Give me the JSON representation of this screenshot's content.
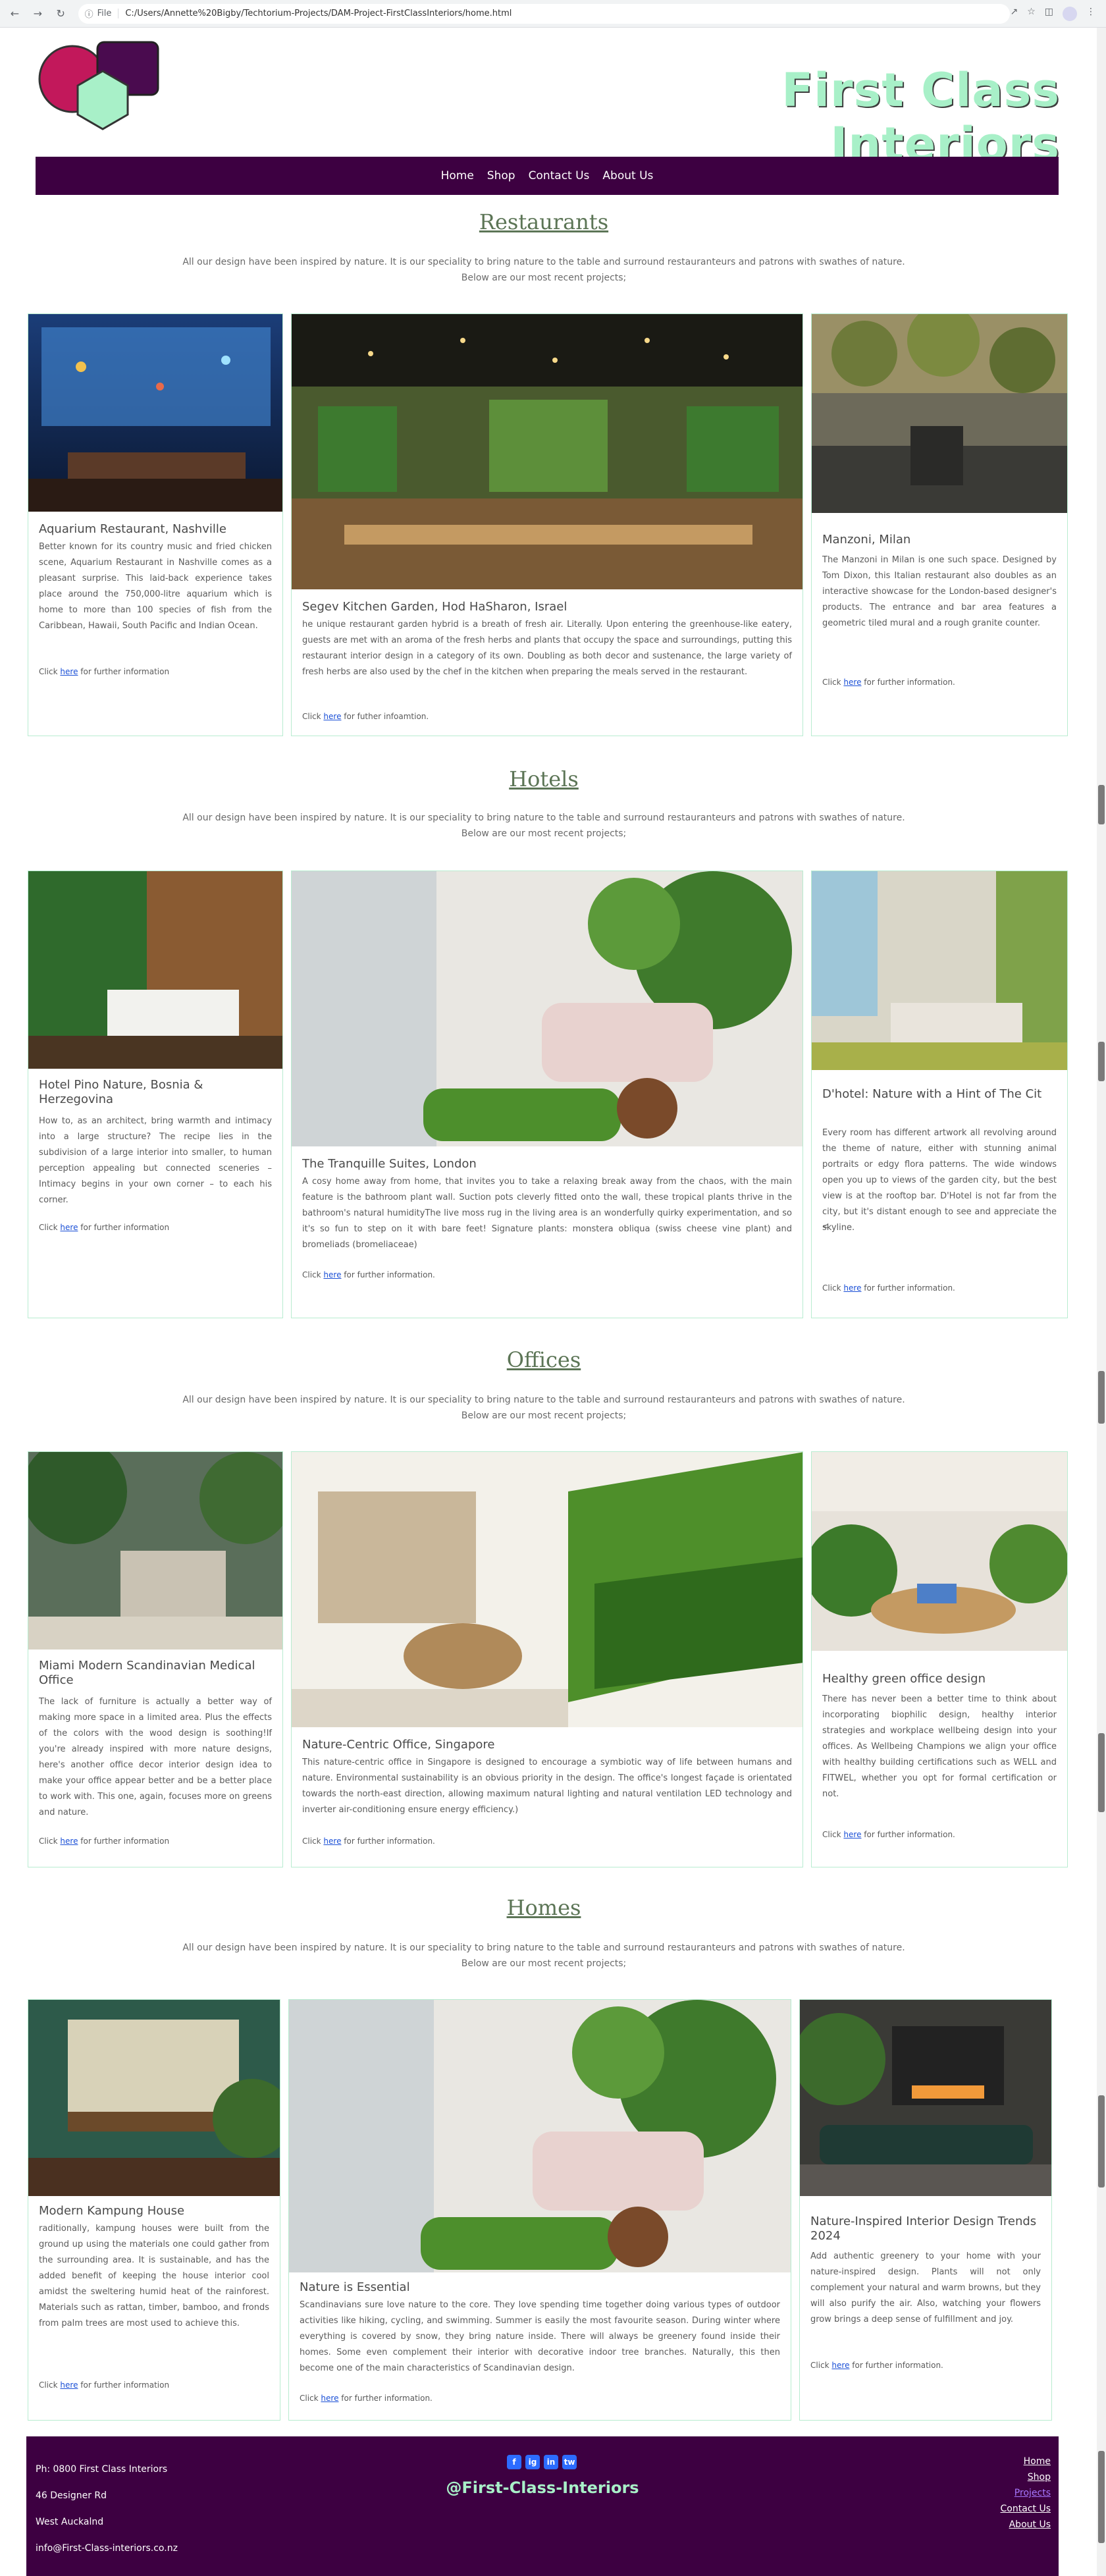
{
  "browser": {
    "scheme_label": "File",
    "url": "C:/Users/Annette%20Bigby/Techtorium-Projects/DAM-Project-FirstClassInteriors/home.html"
  },
  "header": {
    "site_title": "First Class Interiors",
    "nav": [
      "Home",
      "Shop",
      "Contact Us",
      "About Us"
    ]
  },
  "sections": [
    {
      "title": "Restaurants",
      "intro": "All our design have been inspired by nature. It is our speciality to bring nature to the table and surround restauranteurs and patrons with swathes of nature.",
      "intro2": "Below are our most recent projects;",
      "cards": [
        {
          "title": "Aquarium Restaurant, Nashville",
          "text": "Better known for its country music and fried chicken scene, Aquarium Restaurant in Nashville comes as a pleasant surprise. This laid-back experience takes place around the 750,000-litre aquarium which is home to more than 100 species of fish from the Caribbean, Hawaii, South Pacific and Indian Ocean.",
          "more": "Click ",
          "link": "here",
          "after": " for further information"
        },
        {
          "title": "Segev Kitchen Garden, Hod HaSharon, Israel",
          "text": "he unique restaurant garden hybrid is a breath of fresh air. Literally. Upon entering the greenhouse-like eatery, guests are met with an aroma of the fresh herbs and plants that occupy the space and surroundings, putting this restaurant interior design in a category of its own. Doubling as both decor and sustenance, the large variety of fresh herbs are also used by the chef in the kitchen when preparing the meals served in the restaurant.",
          "more": "Click ",
          "link": "here",
          "after": " for futher infoamtion."
        },
        {
          "title": "Manzoni, Milan",
          "text": "The Manzoni in Milan is one such space. Designed by Tom Dixon, this Italian restaurant also doubles as an interactive showcase for the London-based designer's products. The entrance and bar area features a geometric tiled mural and a rough granite counter.",
          "more": "Click ",
          "link": "here",
          "after": " for further information."
        }
      ]
    },
    {
      "title": "Hotels",
      "intro": "All our design have been inspired by nature. It is our speciality to bring nature to the table and surround restauranteurs and patrons with swathes of nature.",
      "intro2": "Below are our most recent projects;",
      "cards": [
        {
          "title": "Hotel Pino Nature, Bosnia & Herzegovina",
          "text": "How to, as an architect, bring warmth and intimacy into a large structure? The recipe lies in the subdivision of a large interior into smaller, to human perception appealing but connected sceneries – Intimacy begins in your own corner – to each his corner.",
          "more": "Click ",
          "link": "here",
          "after": " for further information"
        },
        {
          "title": "The Tranquille Suites, London",
          "text": "A cosy home away from home, that invites you to take a relaxing break away from the chaos, with the main feature is the bathroom plant wall. Suction pots cleverly fitted onto the wall, these tropical plants thrive in the bathroom's natural humidityThe live moss rug in the living area is an wonderfully quirky experimentation, and so it's so fun to step on it with bare feet! Signature plants: monstera obliqua (swiss cheese vine plant) and bromeliads (bromeliaceae)",
          "more": "Click ",
          "link": "here",
          "after": " for further information."
        },
        {
          "title": "D'hotel: Nature with a Hint of The Cit",
          "text": "Every room has different artwork all revolving around the theme of nature, either with stunning animal portraits or edgy flora patterns. The wide windows open you up to views of the garden city, but the best view is at the rooftop bar. D'Hotel is not far from the city, but it's distant enough to see and appreciate the skyline.",
          "extra": "<",
          "more": "Click ",
          "link": "here",
          "after": " for further information."
        }
      ]
    },
    {
      "title": "Offices",
      "intro": "All our design have been inspired by nature. It is our speciality to bring nature to the table and surround restauranteurs and patrons with swathes of nature.",
      "intro2": "Below are our most recent projects;",
      "cards": [
        {
          "title": "Miami Modern Scandinavian Medical Office",
          "text": "The lack of furniture is actually a better way of making more space in a limited area. Plus the effects of the colors with the wood design is soothing!If you're already inspired with more nature designs, here's another office decor interior design idea to make your office appear better and be a better place to work with. This one, again, focuses more on greens and nature.",
          "more": "Click ",
          "link": "here",
          "after": " for further information"
        },
        {
          "title": "Nature-Centric Office, Singapore",
          "text": "This nature-centric office in Singapore is designed to encourage a symbiotic way of life between humans and nature. Environmental sustainability is an obvious priority in the design. The office's longest façade is orientated towards the north-east direction, allowing maximum natural lighting and natural ventilation LED technology and inverter air-conditioning ensure energy efficiency.)",
          "more": "Click ",
          "link": "here",
          "after": " for further information."
        },
        {
          "title": "Healthy green office design",
          "text": "There has never been a better time to think about incorporating biophilic design, healthy interior strategies and workplace wellbeing design into your offices. As Wellbeing Champions we align your office with healthy building certifications such as WELL and FITWEL, whether you opt for formal certification or not.",
          "more": "Click ",
          "link": "here",
          "after": " for further information."
        }
      ]
    },
    {
      "title": "Homes",
      "intro": "All our design have been inspired by nature. It is our speciality to bring nature to the table and surround restauranteurs and patrons with swathes of nature.",
      "intro2": "Below are our most recent projects;",
      "cards": [
        {
          "title": "Modern Kampung House",
          "text": "raditionally, kampung houses were built from the ground up using the materials one could gather from the surrounding area. It is sustainable, and has the added benefit of keeping the house interior cool amidst the sweltering humid heat of the rainforest. Materials such as rattan, timber, bamboo, and fronds from palm trees are most used to achieve this.",
          "more": "Click ",
          "link": "here",
          "after": " for further information"
        },
        {
          "title": "Nature is Essential",
          "text": "Scandinavians sure love nature to the core. They love spending time together doing various types of outdoor activities like hiking, cycling, and swimming. Summer is easily the most favourite season. During winter where everything is covered by snow, they bring nature inside. There will always be greenery found inside their homes. Some even complement their interior with decorative indoor tree branches. Naturally, this then become one of the main characteristics of Scandinavian design.",
          "more": "Click ",
          "link": "here",
          "after": " for further information."
        },
        {
          "title": "Nature-Inspired Interior Design Trends 2024",
          "text": "Add authentic greenery to your home with your nature-inspired design. Plants will not only complement your natural and warm browns, but they will also purify the air. Also, watching your flowers grow brings a deep sense of fulfillment and joy.",
          "more": "Click ",
          "link": "here",
          "after": " for further information."
        }
      ]
    }
  ],
  "footer": {
    "phone": "Ph: 0800 First Class Interiors",
    "address1": "46 Designer Rd",
    "address2": "West Auckalnd",
    "email": "info@First-Class-interiors.co.nz",
    "handle": "@First-Class-Interiors",
    "social": [
      "f",
      "ig",
      "in",
      "tw"
    ],
    "links": [
      "Home",
      "Shop",
      "Projects",
      "Contact Us",
      "About Us"
    ]
  },
  "colors": {
    "brand_purple": "#3d0041",
    "mint": "#a8f0c8",
    "heading_green": "#5c7556",
    "logo_magenta": "#c2185b"
  }
}
